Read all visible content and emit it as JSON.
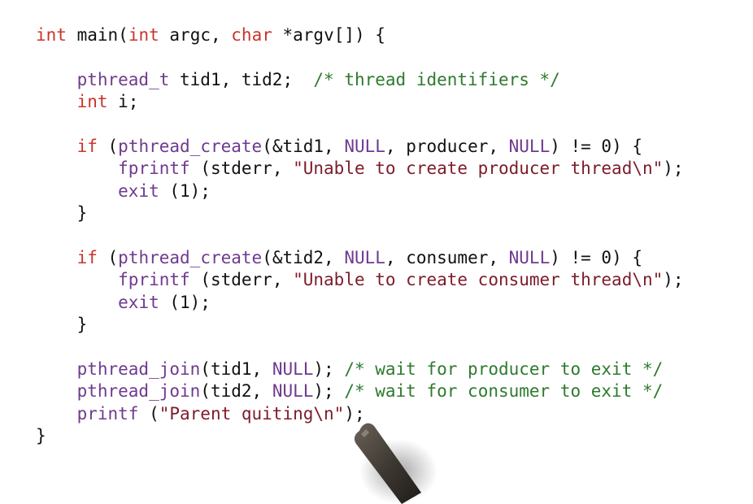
{
  "colors": {
    "background": "#ffffff",
    "keyword": "#c8352c",
    "function": "#6f3a8e",
    "string": "#7d1c2a",
    "comment": "#2e7a2e",
    "plain": "#111111"
  },
  "code": {
    "lines": [
      [
        {
          "t": "int",
          "k": "type"
        },
        {
          "t": " ",
          "k": "plain"
        },
        {
          "t": "main",
          "k": "plain"
        },
        {
          "t": "(",
          "k": "plain"
        },
        {
          "t": "int",
          "k": "type"
        },
        {
          "t": " argc, ",
          "k": "plain"
        },
        {
          "t": "char",
          "k": "type"
        },
        {
          "t": " *argv[]) {",
          "k": "plain"
        }
      ],
      [],
      [
        {
          "t": "    ",
          "k": "plain"
        },
        {
          "t": "pthread_t",
          "k": "fn"
        },
        {
          "t": " tid1, tid2;  ",
          "k": "plain"
        },
        {
          "t": "/* thread identifiers */",
          "k": "com"
        }
      ],
      [
        {
          "t": "    ",
          "k": "plain"
        },
        {
          "t": "int",
          "k": "type"
        },
        {
          "t": " i;",
          "k": "plain"
        }
      ],
      [],
      [
        {
          "t": "    ",
          "k": "plain"
        },
        {
          "t": "if",
          "k": "kw"
        },
        {
          "t": " (",
          "k": "plain"
        },
        {
          "t": "pthread_create",
          "k": "fn"
        },
        {
          "t": "(&tid1, ",
          "k": "plain"
        },
        {
          "t": "NULL",
          "k": "null"
        },
        {
          "t": ", producer, ",
          "k": "plain"
        },
        {
          "t": "NULL",
          "k": "null"
        },
        {
          "t": ") != 0) {",
          "k": "plain"
        }
      ],
      [
        {
          "t": "        ",
          "k": "plain"
        },
        {
          "t": "fprintf",
          "k": "fn"
        },
        {
          "t": " (stderr, ",
          "k": "plain"
        },
        {
          "t": "\"Unable to create producer thread\\n\"",
          "k": "str"
        },
        {
          "t": ");",
          "k": "plain"
        }
      ],
      [
        {
          "t": "        ",
          "k": "plain"
        },
        {
          "t": "exit",
          "k": "fn"
        },
        {
          "t": " (1);",
          "k": "plain"
        }
      ],
      [
        {
          "t": "    }",
          "k": "plain"
        }
      ],
      [],
      [
        {
          "t": "    ",
          "k": "plain"
        },
        {
          "t": "if",
          "k": "kw"
        },
        {
          "t": " (",
          "k": "plain"
        },
        {
          "t": "pthread_create",
          "k": "fn"
        },
        {
          "t": "(&tid2, ",
          "k": "plain"
        },
        {
          "t": "NULL",
          "k": "null"
        },
        {
          "t": ", consumer, ",
          "k": "plain"
        },
        {
          "t": "NULL",
          "k": "null"
        },
        {
          "t": ") != 0) {",
          "k": "plain"
        }
      ],
      [
        {
          "t": "        ",
          "k": "plain"
        },
        {
          "t": "fprintf",
          "k": "fn"
        },
        {
          "t": " (stderr, ",
          "k": "plain"
        },
        {
          "t": "\"Unable to create consumer thread\\n\"",
          "k": "str"
        },
        {
          "t": ");",
          "k": "plain"
        }
      ],
      [
        {
          "t": "        ",
          "k": "plain"
        },
        {
          "t": "exit",
          "k": "fn"
        },
        {
          "t": " (1);",
          "k": "plain"
        }
      ],
      [
        {
          "t": "    }",
          "k": "plain"
        }
      ],
      [],
      [
        {
          "t": "    ",
          "k": "plain"
        },
        {
          "t": "pthread_join",
          "k": "fn"
        },
        {
          "t": "(tid1, ",
          "k": "plain"
        },
        {
          "t": "NULL",
          "k": "null"
        },
        {
          "t": "); ",
          "k": "plain"
        },
        {
          "t": "/* wait for producer to exit */",
          "k": "com"
        }
      ],
      [
        {
          "t": "    ",
          "k": "plain"
        },
        {
          "t": "pthread_join",
          "k": "fn"
        },
        {
          "t": "(tid2, ",
          "k": "plain"
        },
        {
          "t": "NULL",
          "k": "null"
        },
        {
          "t": "); ",
          "k": "plain"
        },
        {
          "t": "/* wait for consumer to exit */",
          "k": "com"
        }
      ],
      [
        {
          "t": "    ",
          "k": "plain"
        },
        {
          "t": "printf",
          "k": "fn"
        },
        {
          "t": " (",
          "k": "plain"
        },
        {
          "t": "\"Parent quiting\\n\"",
          "k": "str"
        },
        {
          "t": ");",
          "k": "plain"
        }
      ],
      [
        {
          "t": "}",
          "k": "plain"
        }
      ]
    ]
  },
  "stylus": {
    "icon": "stylus-pen-icon"
  }
}
